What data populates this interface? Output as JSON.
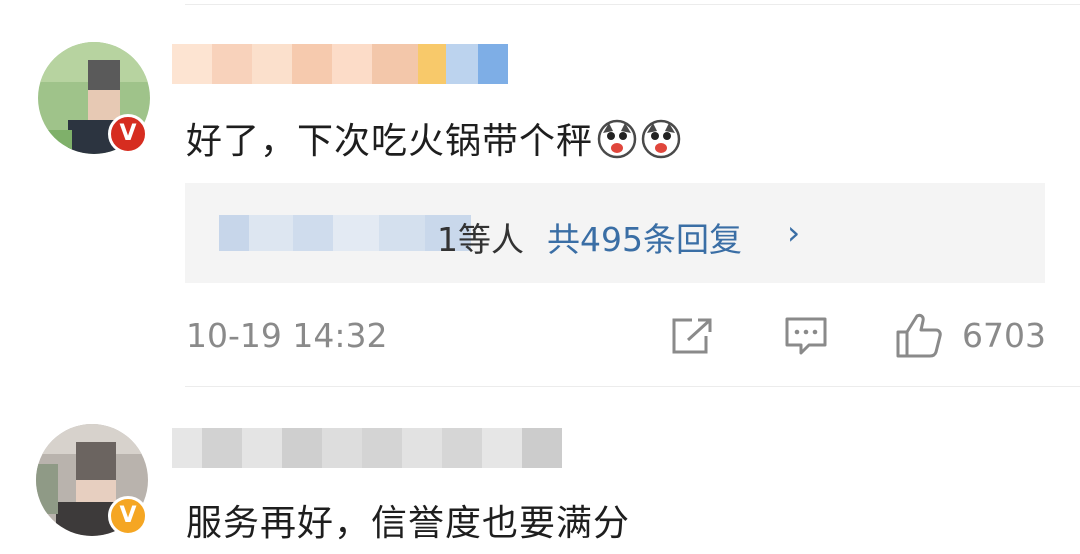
{
  "comments": [
    {
      "text": "好了，下次吃火锅带个秤",
      "reactions": [
        "husky-laugh-icon",
        "husky-laugh-icon"
      ],
      "badge": "V",
      "replies": {
        "names_suffix": "1等人",
        "count_label": "共495条回复",
        "chevron": "›"
      },
      "timestamp": "10-19 14:32",
      "likes": "6703"
    },
    {
      "text": "服务再好，信誉度也要满分",
      "badge": "V"
    }
  ],
  "colors": {
    "badge_red": "#d62d20",
    "badge_orange": "#f5a623",
    "link_blue": "#3a6ea5",
    "meta_gray": "#8a8a8a"
  }
}
